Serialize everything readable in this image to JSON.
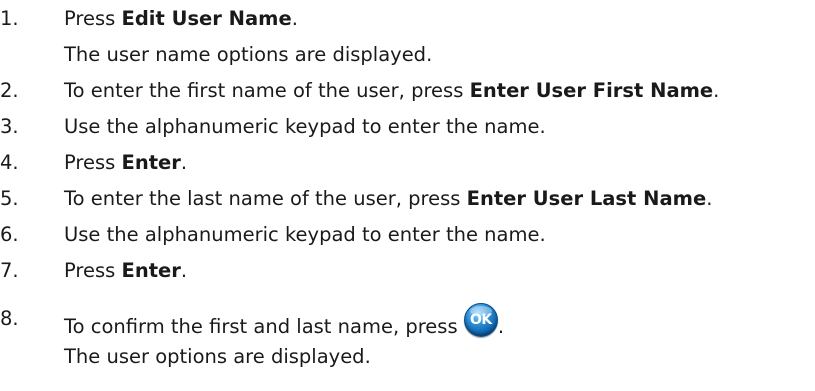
{
  "steps": [
    {
      "num": "1.",
      "pre": "Press ",
      "bold": "Edit User Name",
      "post": "."
    },
    {
      "result": "The user name options are displayed."
    },
    {
      "num": "2.",
      "pre": "To enter the first name of the user, press ",
      "bold": "Enter User First Name",
      "post": "."
    },
    {
      "num": "3.",
      "pre": "Use the alphanumeric keypad to enter the name.",
      "bold": "",
      "post": ""
    },
    {
      "num": "4.",
      "pre": "Press ",
      "bold": "Enter",
      "post": "."
    },
    {
      "num": "5.",
      "pre": "To enter the last name of the user, press ",
      "bold": "Enter User Last Name",
      "post": "."
    },
    {
      "num": "6.",
      "pre": "Use the alphanumeric keypad to enter the name.",
      "bold": "",
      "post": ""
    },
    {
      "num": "7.",
      "pre": "Press ",
      "bold": "Enter",
      "post": "."
    },
    {
      "num": "8.",
      "pre": "To confirm the first and last name, press ",
      "button": "OK",
      "post": "."
    },
    {
      "result": "The user options are displayed."
    }
  ]
}
